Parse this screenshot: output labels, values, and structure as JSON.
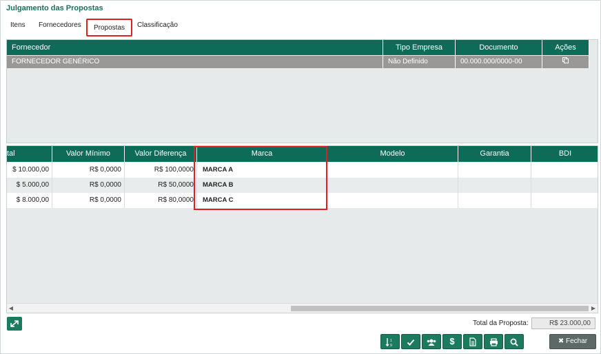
{
  "window": {
    "title": "Julgamento das Propostas"
  },
  "tabs": [
    {
      "label": "Itens"
    },
    {
      "label": "Fornecedores"
    },
    {
      "label": "Propostas"
    },
    {
      "label": "Classificação"
    }
  ],
  "active_tab": "Propostas",
  "suppliers_grid": {
    "headers": [
      "Fornecedor",
      "Tipo Empresa",
      "Documento",
      "Ações"
    ],
    "rows": [
      {
        "fornecedor": "FORNECEDOR GENÉRICO",
        "tipo_empresa": "Não Definido",
        "documento": "00.000.000/0000-00",
        "acoes_icon": "copy-icon"
      }
    ]
  },
  "proposals_grid": {
    "headers": [
      "tal",
      "Valor Mínimo",
      "Valor Diferença",
      "Marca",
      "Modelo",
      "Garantia",
      "BDI"
    ],
    "rows": [
      {
        "total": "$ 10.000,00",
        "valor_minimo": "R$ 0,0000",
        "valor_diferenca": "R$ 100,0000",
        "marca": "MARCA A",
        "modelo": "",
        "garantia": "",
        "bdi": ""
      },
      {
        "total": "$ 5.000,00",
        "valor_minimo": "R$ 0,0000",
        "valor_diferenca": "R$ 50,0000",
        "marca": "MARCA B",
        "modelo": "",
        "garantia": "",
        "bdi": ""
      },
      {
        "total": "$ 8.000,00",
        "valor_minimo": "R$ 0,0000",
        "valor_diferenca": "R$ 80,0000",
        "marca": "MARCA C",
        "modelo": "",
        "garantia": "",
        "bdi": ""
      }
    ]
  },
  "footer": {
    "total_label": "Total da Proposta:",
    "total_value": "R$ 23.000,00",
    "close_label": "Fechar",
    "action_icons": [
      "sort-icon",
      "check-icon",
      "users-icon",
      "dollar-icon",
      "document-icon",
      "print-icon",
      "search-icon"
    ]
  },
  "colors": {
    "header_green": "#0d6b57",
    "button_green": "#1c7a5e",
    "selected_row": "#9a9797",
    "highlight_red": "#e02020"
  }
}
